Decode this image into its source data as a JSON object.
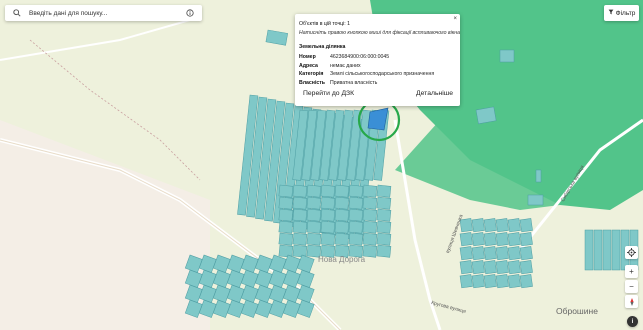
{
  "search": {
    "placeholder": "Введіть дані для пошуку..."
  },
  "filter": {
    "label": "Фільтр"
  },
  "popup": {
    "objects_count": "Об'єктів в цій точці: 1",
    "hint": "Натисніть правою кнопкою миші для фіксації вспливаючого вікна",
    "section_title": "Земельна ділянка",
    "fields": [
      {
        "key": "Номер",
        "value": "4623684900:06:000:0045"
      },
      {
        "key": "Адреса",
        "value": "немає даних"
      },
      {
        "key": "Категорія",
        "value": "Землі сільськогосподарського призначення"
      },
      {
        "key": "Власність",
        "value": "Приватна власність"
      }
    ],
    "goto_button": "Перейти до ДЗК",
    "details_button": "Детальніше",
    "close": "×"
  },
  "map_labels": {
    "street_a": "вулиця Шевченка",
    "street_b": "Кругова вулиця",
    "street_c": "Сибірська вулиця",
    "place_a": "Нова Дорога",
    "place_b": "Оброшине"
  },
  "colors": {
    "parcel": "#7fc8c8",
    "parcel_selected": "#3a8fd6",
    "forest": "#52c48a",
    "highlight": "#27a84a"
  },
  "icons": {
    "search": "search-icon",
    "info": "info-icon",
    "filter": "filter-icon",
    "locate": "locate-icon",
    "zoom_in": "zoom-in-icon",
    "zoom_out": "zoom-out-icon",
    "compass": "compass-icon",
    "attribution": "info-icon"
  }
}
